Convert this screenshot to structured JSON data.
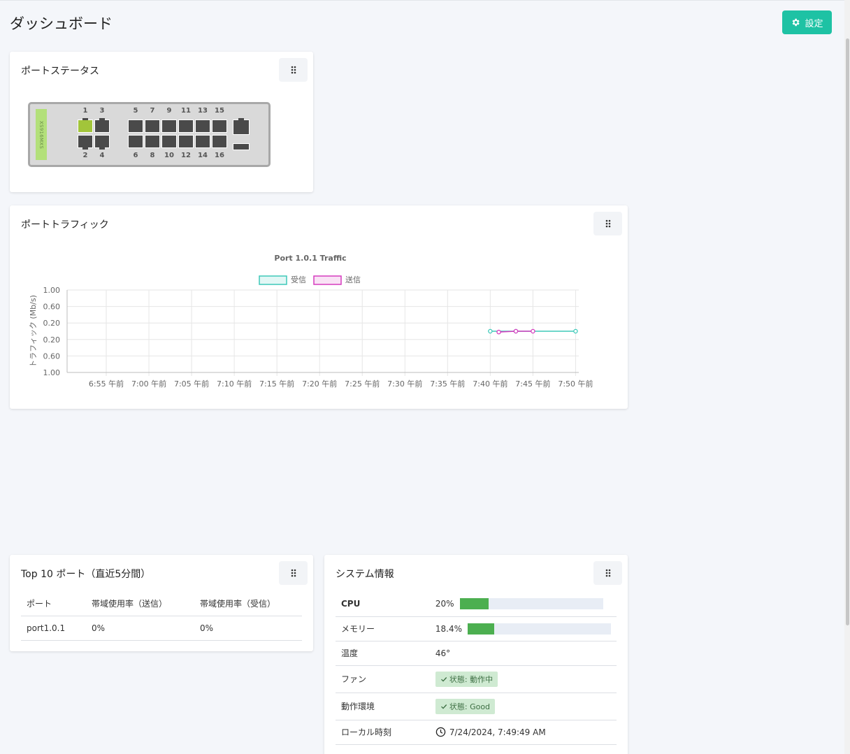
{
  "page": {
    "title": "ダッシュボード",
    "settings_label": "設定"
  },
  "port_status": {
    "title": "ポートステータス",
    "model": "XS916MXS",
    "top_labels": [
      "1",
      "3",
      "5",
      "7",
      "9",
      "11",
      "13",
      "15"
    ],
    "bottom_labels": [
      "2",
      "4",
      "6",
      "8",
      "10",
      "12",
      "14",
      "16"
    ],
    "active_ports": [
      "1"
    ]
  },
  "traffic": {
    "title": "ポートトラフィック",
    "chart_data": {
      "type": "line",
      "title": "Port 1.0.1 Traffic",
      "ylabel": "トラフィック (Mb/s)",
      "xlabel": "",
      "y_tick_labels": [
        "1.00",
        "0.60",
        "0.20",
        "0.20",
        "0.60",
        "1.00"
      ],
      "ylim": [
        -1,
        1
      ],
      "x_tick_labels": [
        "6:55 午前",
        "7:00 午前",
        "7:05 午前",
        "7:10 午前",
        "7:15 午前",
        "7:20 午前",
        "7:25 午前",
        "7:30 午前",
        "7:35 午前",
        "7:40 午前",
        "7:45 午前",
        "7:50 午前"
      ],
      "legend_position": "top",
      "grid": true,
      "series": [
        {
          "name": "受信",
          "color": "#3ec9b9",
          "points": [
            [
              "7:40 午前",
              0.0
            ],
            [
              "7:43 午前",
              0.0
            ],
            [
              "7:50 午前",
              0.0
            ]
          ]
        },
        {
          "name": "送信",
          "color": "#d63cbf",
          "points": [
            [
              "7:41 午前",
              -0.02
            ],
            [
              "7:43 午前",
              0.0
            ],
            [
              "7:45 午前",
              0.0
            ]
          ]
        }
      ]
    }
  },
  "top10": {
    "title": "Top 10 ポート（直近5分間）",
    "headers": [
      "ポート",
      "帯域使用率（送信）",
      "帯域使用率（受信）"
    ],
    "rows": [
      [
        "port1.0.1",
        "0%",
        "0%"
      ]
    ]
  },
  "sysinfo": {
    "title": "システム情報",
    "cpu_label": "CPU",
    "cpu_value": "20%",
    "cpu_percent": 20,
    "memory_label": "メモリー",
    "memory_value": "18.4%",
    "memory_percent": 18.4,
    "temp_label": "温度",
    "temp_value": "46°",
    "fan_label": "ファン",
    "fan_value": "状態: 動作中",
    "env_label": "動作環境",
    "env_value": "状態: Good",
    "time_label": "ローカル時刻",
    "time_value": "7/24/2024, 7:49:49 AM"
  }
}
